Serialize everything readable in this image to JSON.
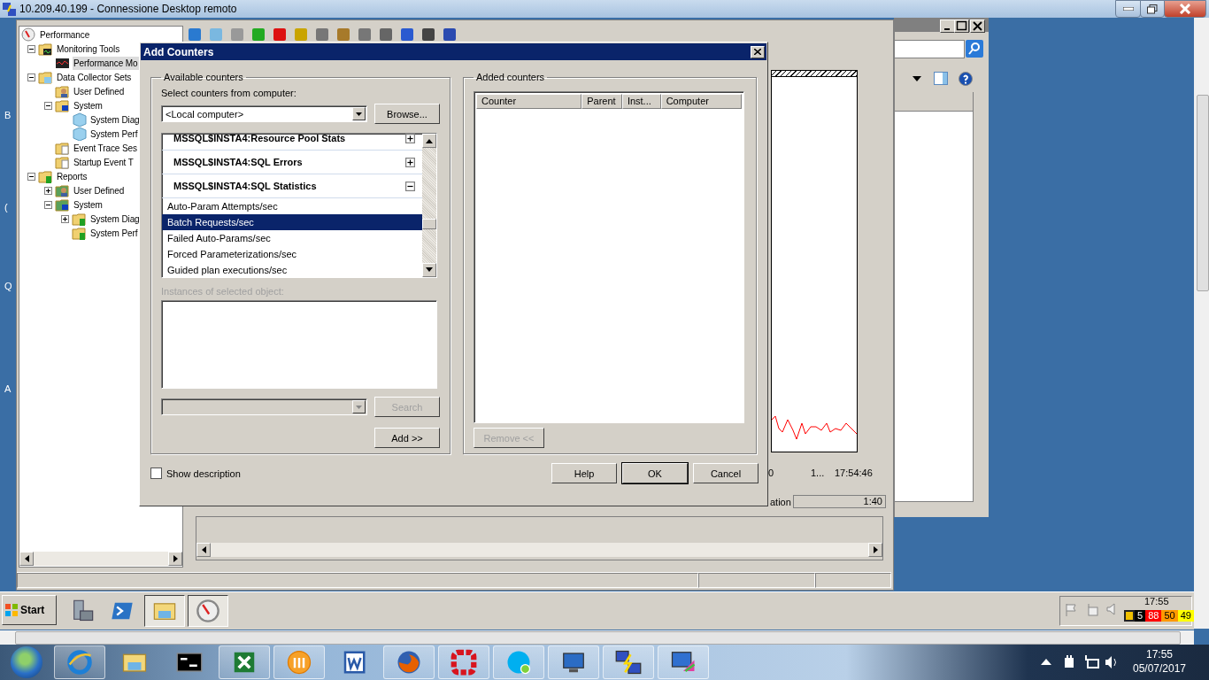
{
  "rdp_window": {
    "title": "10.209.40.199 - Connessione Desktop remoto"
  },
  "desktop_fragments": [
    "B",
    "(",
    "Q",
    "A"
  ],
  "mmc": {
    "tree": [
      {
        "label": "Performance",
        "kind": "gauge",
        "selected": false,
        "children": [
          {
            "label": "Monitoring Tools",
            "kind": "tools",
            "expandable": true,
            "expanded": true,
            "selected": false,
            "children": [
              {
                "label": "Performance Mo",
                "kind": "monitor",
                "expandable": false,
                "selected": true
              }
            ]
          },
          {
            "label": "Data Collector Sets",
            "kind": "sets",
            "expandable": true,
            "expanded": true,
            "selected": false,
            "children": [
              {
                "label": "User Defined",
                "kind": "user",
                "expandable": false,
                "selected": false
              },
              {
                "label": "System",
                "kind": "system",
                "expandable": true,
                "expanded": true,
                "selected": false,
                "children": [
                  {
                    "label": "System Diag",
                    "kind": "cube",
                    "expandable": false,
                    "selected": false
                  },
                  {
                    "label": "System Perf",
                    "kind": "cube",
                    "expandable": false,
                    "selected": false
                  }
                ]
              },
              {
                "label": "Event Trace Ses",
                "kind": "trace",
                "expandable": false,
                "selected": false
              },
              {
                "label": "Startup Event T",
                "kind": "trace",
                "expandable": false,
                "selected": false
              }
            ]
          },
          {
            "label": "Reports",
            "kind": "report",
            "expandable": true,
            "expanded": true,
            "selected": false,
            "children": [
              {
                "label": "User Defined",
                "kind": "report-user",
                "expandable": true,
                "expanded": false,
                "selected": false
              },
              {
                "label": "System",
                "kind": "report-system",
                "expandable": true,
                "expanded": true,
                "selected": false,
                "children": [
                  {
                    "label": "System Diag",
                    "kind": "report",
                    "expandable": true,
                    "expanded": false,
                    "selected": false
                  },
                  {
                    "label": "System Perf",
                    "kind": "report",
                    "expandable": false,
                    "selected": false
                  }
                ]
              }
            ]
          }
        ]
      }
    ],
    "x_labels": [
      "0",
      "1...",
      "17:54:46"
    ],
    "duration": {
      "label": "ation",
      "value": "1:40"
    }
  },
  "dialog": {
    "title": "Add Counters",
    "available": {
      "heading": "Available counters",
      "computer_label": "Select counters from computer:",
      "computer": "<Local computer>",
      "browse": "Browse...",
      "items": [
        {
          "kind": "object",
          "label": "MSSQL$INSTA4:Resource Pool Stats",
          "expanded": false,
          "selected": false
        },
        {
          "kind": "object",
          "label": "MSSQL$INSTA4:SQL Errors",
          "expanded": false,
          "selected": false
        },
        {
          "kind": "object",
          "label": "MSSQL$INSTA4:SQL Statistics",
          "expanded": true,
          "selected": false
        },
        {
          "kind": "counter",
          "label": "Auto-Param Attempts/sec",
          "selected": false
        },
        {
          "kind": "counter",
          "label": "Batch Requests/sec",
          "selected": true
        },
        {
          "kind": "counter",
          "label": "Failed Auto-Params/sec",
          "selected": false
        },
        {
          "kind": "counter",
          "label": "Forced Parameterizations/sec",
          "selected": false
        },
        {
          "kind": "counter",
          "label": "Guided plan executions/sec",
          "selected": false
        }
      ],
      "instances_label": {
        "text": "Instances of selected object:",
        "disabled": true
      },
      "search": {
        "label": "Search",
        "disabled": true
      },
      "add": {
        "label": "Add >>",
        "disabled": false
      }
    },
    "added": {
      "heading": "Added counters",
      "columns": [
        "Counter",
        "Parent",
        "Inst...",
        "Computer"
      ],
      "remove": {
        "label": "Remove <<",
        "disabled": true
      }
    },
    "show_description": {
      "label": "Show description",
      "checked": false
    },
    "buttons": [
      {
        "label": "Help",
        "default": false
      },
      {
        "label": "OK",
        "default": true
      },
      {
        "label": "Cancel",
        "default": false
      }
    ]
  },
  "remote_taskbar": {
    "start": "Start",
    "apps": [
      {
        "kind": "server",
        "pressed": false
      },
      {
        "kind": "shell",
        "pressed": false
      },
      {
        "kind": "folder",
        "pressed": true
      },
      {
        "kind": "gauge",
        "pressed": true
      }
    ],
    "time": "17:55",
    "counters": [
      {
        "value": "5",
        "color": "#000000"
      },
      {
        "value": "88",
        "color": "#ff0000"
      },
      {
        "value": "50",
        "color": "#ff9900"
      },
      {
        "value": "49",
        "color": "#ffff00"
      }
    ]
  },
  "local_taskbar": {
    "apps": [
      {
        "kind": "globe",
        "running": true
      },
      {
        "kind": "folder",
        "running": false
      },
      {
        "kind": "terminal",
        "running": false
      },
      {
        "kind": "spreadsheet",
        "running": true
      },
      {
        "kind": "circle-logo",
        "running": true
      },
      {
        "kind": "document",
        "running": false
      },
      {
        "kind": "fox",
        "running": true
      },
      {
        "kind": "ring",
        "running": true
      },
      {
        "kind": "chat",
        "running": true
      },
      {
        "kind": "monitor",
        "running": true
      },
      {
        "kind": "network",
        "running": true
      },
      {
        "kind": "palette",
        "running": true
      }
    ],
    "time": "17:55",
    "date": "05/07/2017"
  }
}
